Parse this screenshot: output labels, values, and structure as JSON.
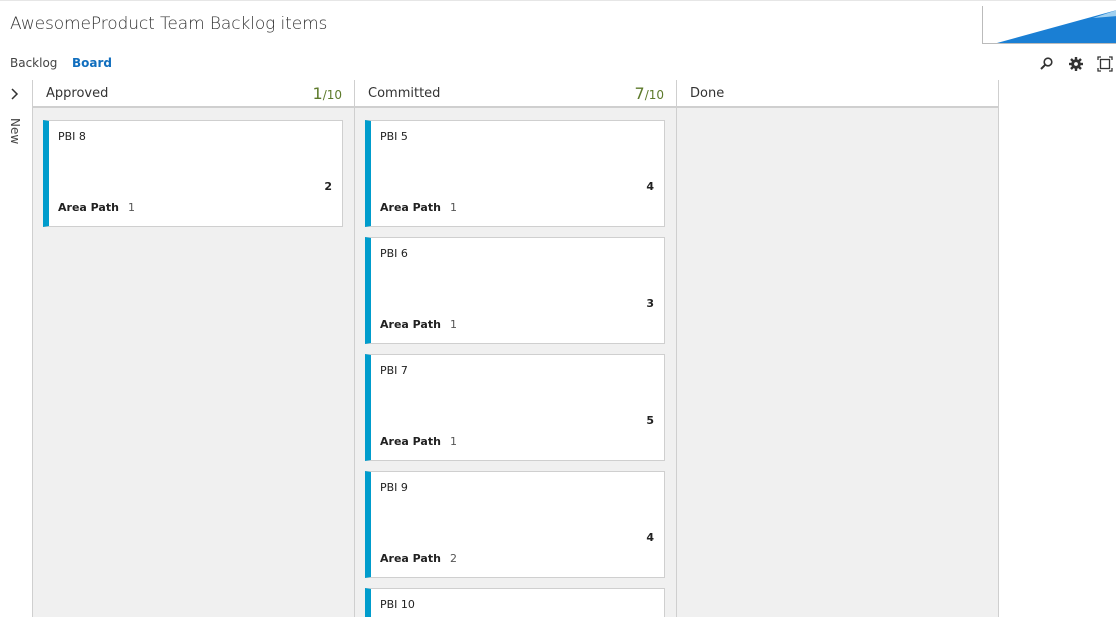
{
  "header": {
    "title": "AwesomeProduct Team Backlog items"
  },
  "nav": {
    "backlog": "Backlog",
    "board": "Board"
  },
  "toolbar": {
    "icons": [
      "search-icon",
      "gear-icon",
      "fullscreen-icon"
    ]
  },
  "swimlane": {
    "label": "New"
  },
  "columns": [
    {
      "name": "Approved",
      "count": "1",
      "limit": "/10",
      "cards": [
        {
          "title": "PBI 8",
          "estimate": "2",
          "field_label": "Area Path",
          "field_value": "1"
        }
      ]
    },
    {
      "name": "Committed",
      "count": "7",
      "limit": "/10",
      "cards": [
        {
          "title": "PBI 5",
          "estimate": "4",
          "field_label": "Area Path",
          "field_value": "1"
        },
        {
          "title": "PBI 6",
          "estimate": "3",
          "field_label": "Area Path",
          "field_value": "1"
        },
        {
          "title": "PBI 7",
          "estimate": "5",
          "field_label": "Area Path",
          "field_value": "1"
        },
        {
          "title": "PBI 9",
          "estimate": "4",
          "field_label": "Area Path",
          "field_value": "2"
        },
        {
          "title": "PBI 10",
          "estimate": "",
          "field_label": "",
          "field_value": ""
        }
      ]
    },
    {
      "name": "Done",
      "count": "",
      "limit": "",
      "cards": []
    }
  ],
  "colors": {
    "card_accent": "#009ccc",
    "link_active": "#106ebe",
    "limit_text": "#5d7a2b"
  }
}
